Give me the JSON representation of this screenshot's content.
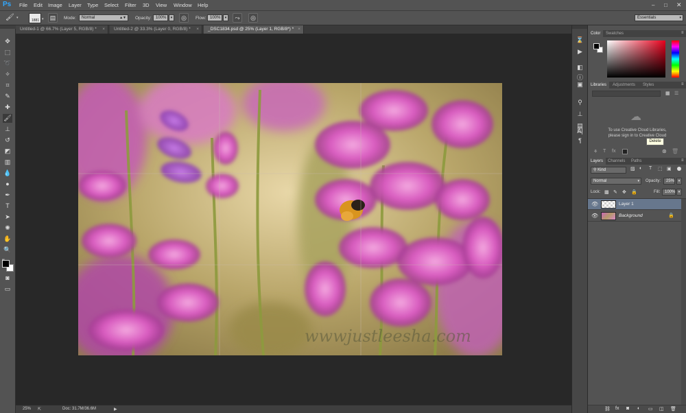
{
  "app": {
    "logo": "Ps"
  },
  "menu": [
    "File",
    "Edit",
    "Image",
    "Layer",
    "Type",
    "Select",
    "Filter",
    "3D",
    "View",
    "Window",
    "Help"
  ],
  "options": {
    "brush_size": "1881",
    "mode_label": "Mode:",
    "mode_value": "Normal",
    "opacity_label": "Opacity:",
    "opacity_value": "100%",
    "flow_label": "Flow:",
    "flow_value": "100%",
    "workspace": "Essentials"
  },
  "tabs": [
    {
      "title": "Untitled-1 @ 66.7% (Layer 5, RGB/8) *"
    },
    {
      "title": "Untitled-2 @ 33.3% (Layer 0, RGB/8) *"
    },
    {
      "title": "_DSC1834.psd @ 25% (Layer 1, RGB/8*) *"
    }
  ],
  "canvas": {
    "watermark": "wwwjustleesha.com"
  },
  "status": {
    "zoom": "25%",
    "doc": "Doc: 31.7M/36.6M"
  },
  "color_panel": {
    "tabs": [
      "Color",
      "Swatches"
    ]
  },
  "libraries_panel": {
    "tabs": [
      "Libraries",
      "Adjustments",
      "Styles"
    ],
    "message": "To use Creative Cloud Libraries, please sign in to Creative Cloud"
  },
  "tooltip": "Delete",
  "layers_panel": {
    "tabs": [
      "Layers",
      "Channels",
      "Paths"
    ],
    "kind_label": "Kind",
    "blend_mode": "Normal",
    "opacity_label": "Opacity:",
    "opacity_value": "25%",
    "lock_label": "Lock:",
    "fill_label": "Fill:",
    "fill_value": "100%",
    "layers": [
      {
        "name": "Layer 1",
        "selected": true
      },
      {
        "name": "Background",
        "selected": false
      }
    ]
  },
  "colors": {
    "accent": "#31a8ff",
    "selected_layer": "#67778d"
  }
}
